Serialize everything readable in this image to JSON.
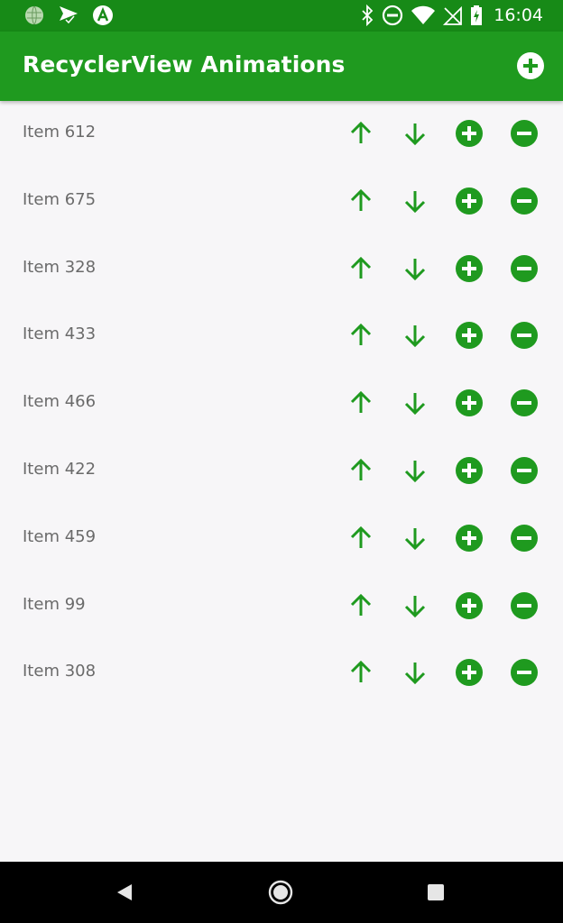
{
  "colors": {
    "status_bar": "#178a17",
    "app_bar": "#1f9a1f",
    "accent": "#1f9a1f",
    "background": "#f7f6f8",
    "item_text": "#6a6a6a",
    "nav_bar": "#000000"
  },
  "status_bar": {
    "time": "16:04",
    "left_icons": [
      "globe-icon",
      "send-check-icon",
      "a-alert-icon"
    ],
    "right_icons": [
      "bluetooth-icon",
      "do-not-disturb-icon",
      "wifi-icon",
      "no-signal-icon",
      "battery-charging-icon"
    ]
  },
  "app_bar": {
    "title": "RecyclerView Animations",
    "action_icon": "add-circle-icon"
  },
  "list": {
    "items": [
      {
        "label": "Item 612"
      },
      {
        "label": "Item 675"
      },
      {
        "label": "Item 328"
      },
      {
        "label": "Item 433"
      },
      {
        "label": "Item 466"
      },
      {
        "label": "Item 422"
      },
      {
        "label": "Item 459"
      },
      {
        "label": "Item 99"
      },
      {
        "label": "Item 308"
      }
    ],
    "row_actions": [
      "arrow-up-icon",
      "arrow-down-icon",
      "add-circle-icon",
      "remove-circle-icon"
    ]
  },
  "nav_bar": {
    "buttons": [
      "back-icon",
      "home-icon",
      "recents-icon"
    ]
  }
}
